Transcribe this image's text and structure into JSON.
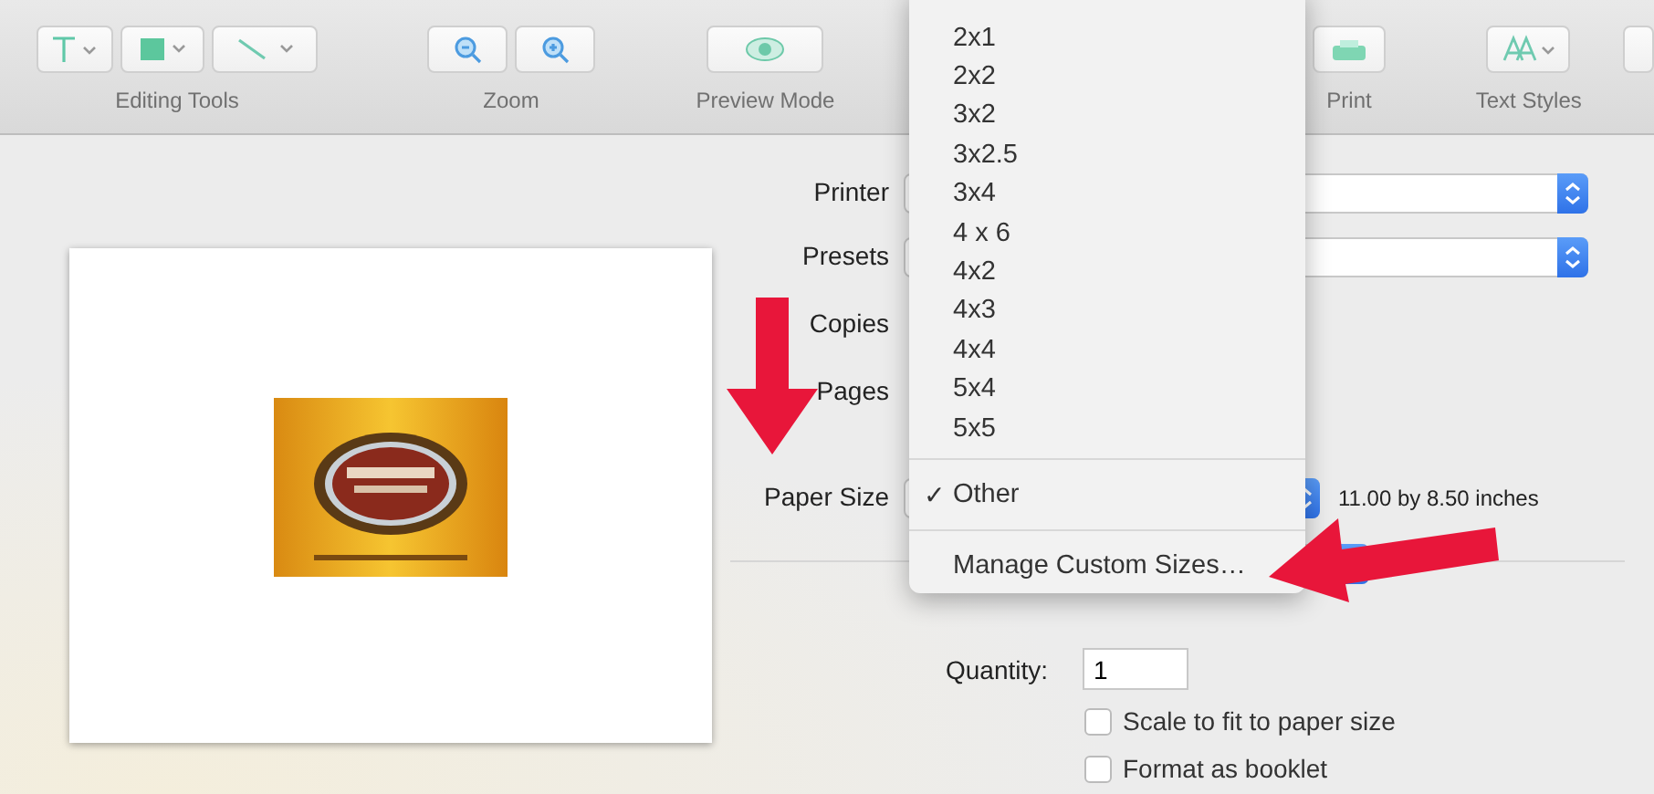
{
  "toolbar": {
    "groups": [
      {
        "label": "Editing Tools",
        "kind": "editing"
      },
      {
        "label": "Zoom",
        "kind": "zoom"
      },
      {
        "label": "Preview Mode",
        "kind": "preview"
      },
      {
        "label": "Print",
        "kind": "print"
      },
      {
        "label": "Text Styles",
        "kind": "text-styles"
      }
    ]
  },
  "form": {
    "rows": [
      {
        "label": "Printer",
        "kind": "popup"
      },
      {
        "label": "Presets",
        "kind": "popup"
      },
      {
        "label": "Copies",
        "kind": "plain"
      },
      {
        "label": "Pages",
        "kind": "plain"
      },
      {
        "label": "Paper Size",
        "kind": "paper",
        "note": "11.00 by 8.50 inches"
      }
    ],
    "quantity": {
      "label": "Quantity:",
      "value": "1"
    },
    "options": [
      {
        "label": "Scale to fit to paper size",
        "checked": false
      },
      {
        "label": "Format as booklet",
        "checked": false
      }
    ]
  },
  "menu": {
    "check_mark": "✓",
    "sections": [
      [
        {
          "label": "2x1",
          "selected": false
        },
        {
          "label": "2x2",
          "selected": false
        },
        {
          "label": "3x2",
          "selected": false
        },
        {
          "label": "3x2.5",
          "selected": false
        },
        {
          "label": "3x4",
          "selected": false
        },
        {
          "label": "4 x 6",
          "selected": false
        },
        {
          "label": "4x2",
          "selected": false
        },
        {
          "label": "4x3",
          "selected": false
        },
        {
          "label": "4x4",
          "selected": false
        },
        {
          "label": "5x4",
          "selected": false
        },
        {
          "label": "5x5",
          "selected": false
        }
      ],
      [
        {
          "label": "Other",
          "selected": true
        }
      ],
      [
        {
          "label": "Manage Custom Sizes…",
          "selected": false
        }
      ]
    ]
  }
}
